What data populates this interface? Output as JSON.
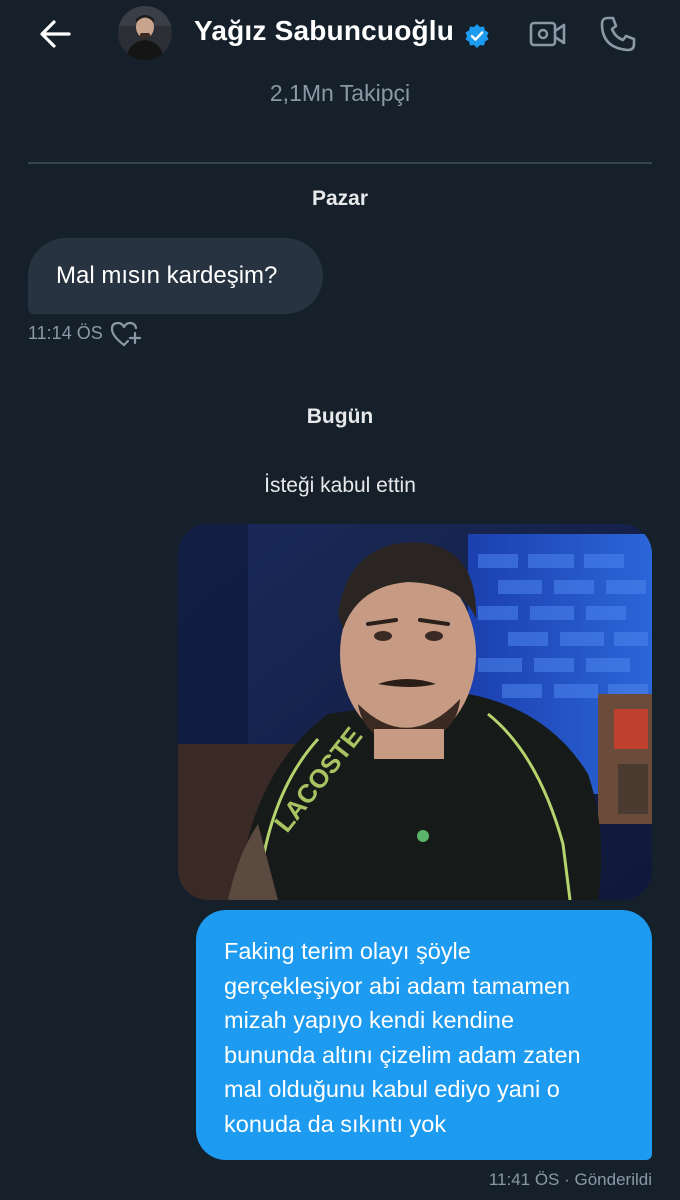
{
  "header": {
    "name": "Yağız Sabuncuoğlu",
    "followers": "2,1Mn Takipçi",
    "icons": {
      "back": "arrow-left-icon",
      "verified": "verified-badge-icon",
      "video": "video-camera-icon",
      "call": "phone-icon"
    }
  },
  "conversation": {
    "day_sunday": "Pazar",
    "day_today": "Bugün",
    "system_message": "İsteği kabul ettin",
    "incoming": {
      "text": "Mal mısın kardeşim?",
      "time": "11:14 ÖS"
    },
    "outgoing": {
      "lines": [
        "Faking terim olayı şöyle",
        "gerçekleşiyor abi adam tamamen",
        "mizah yapıyo kendi kendine",
        "bununda altını çizelim adam zaten",
        "mal olduğunu kabul ediyo yani o",
        "konuda da sıkıntı yok"
      ],
      "status": "11:41 ÖS · Gönderildi"
    },
    "photo_brand": "LACOSTE"
  },
  "colors": {
    "background": "#15202b",
    "incoming_bubble": "#273340",
    "outgoing_bubble": "#1d9bf0",
    "muted_text": "#8b98a5",
    "verified": "#1d9bf0"
  }
}
